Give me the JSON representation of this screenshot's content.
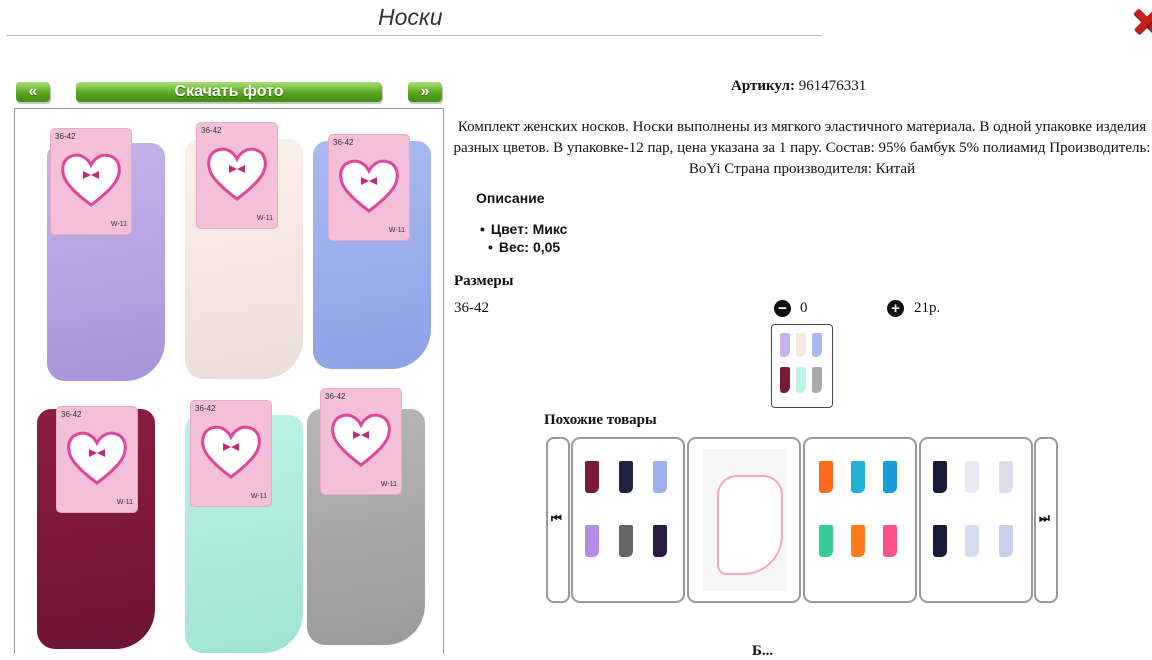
{
  "page": {
    "title": "Носки"
  },
  "gallery": {
    "prev_label": "«",
    "download_label": "Скачать фото",
    "next_label": "»",
    "tag_size": "36-42",
    "tag_code": "W-11"
  },
  "product": {
    "article_label": "Артикул:",
    "article_value": "961476331",
    "description": "Комплект женских носков. Носки выполнены из мягкого эластичного материала. В одной упаковке изделия разных цветов. В упаковке-12 пар, цена указана за 1 пару. Состав: 95% бамбук 5% полиамид Производитель: BoYi Страна производителя: Китай",
    "description_heading": "Описание",
    "specs": [
      "Цвет: Микс",
      "Вес: 0,05"
    ]
  },
  "sizes": {
    "heading": "Размеры",
    "rows": [
      {
        "size": "36-42",
        "minus": "−",
        "quantity": "0",
        "plus": "+",
        "price": "21р."
      }
    ]
  },
  "similar": {
    "heading": "Похожие товары",
    "prev_icon": "skip-back-icon",
    "next_icon": "skip-forward-icon"
  },
  "footer_cutoff": "Б..."
}
